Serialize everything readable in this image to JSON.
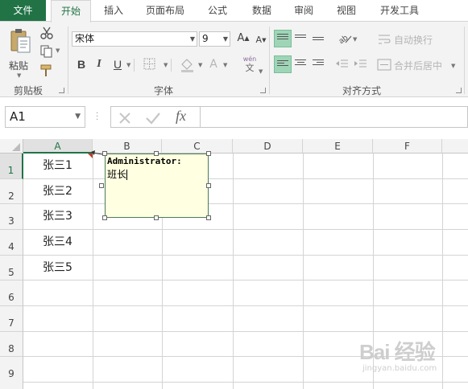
{
  "tabs": [
    {
      "label": "文件"
    },
    {
      "label": "开始"
    },
    {
      "label": "插入"
    },
    {
      "label": "页面布局"
    },
    {
      "label": "公式"
    },
    {
      "label": "数据"
    },
    {
      "label": "审阅"
    },
    {
      "label": "视图"
    },
    {
      "label": "开发工具"
    }
  ],
  "ribbon": {
    "clipboard": {
      "paste_label": "粘贴",
      "group_label": "剪贴板"
    },
    "font": {
      "font_name": "宋体",
      "font_size": "9",
      "bold": "B",
      "italic": "I",
      "underline": "U",
      "grow_font": "A",
      "shrink_font": "A",
      "font_color": "A",
      "phonetic_top": "wén",
      "phonetic_bottom": "文",
      "group_label": "字体"
    },
    "alignment": {
      "wrap_text": "自动换行",
      "merge_center": "合并后居中",
      "group_label": "对齐方式"
    }
  },
  "formula_bar": {
    "name_box": "A1",
    "fx_label": "fx",
    "value": ""
  },
  "columns": [
    "A",
    "B",
    "C",
    "D",
    "E",
    "F"
  ],
  "rows": [
    "1",
    "2",
    "3",
    "4",
    "5",
    "6",
    "7",
    "8",
    "9"
  ],
  "cells": {
    "A1": "张三1",
    "A2": "张三2",
    "A3": "张三3",
    "A4": "张三4",
    "A5": "张三5"
  },
  "comment": {
    "author": "Administrator:",
    "text": "班长"
  },
  "watermark": {
    "brand": "Bai 经验",
    "url": "jingyan.baidu.com"
  },
  "colors": {
    "accent": "#217346",
    "comment_bg": "#ffffe1",
    "selected_button": "#9fd5b7"
  }
}
